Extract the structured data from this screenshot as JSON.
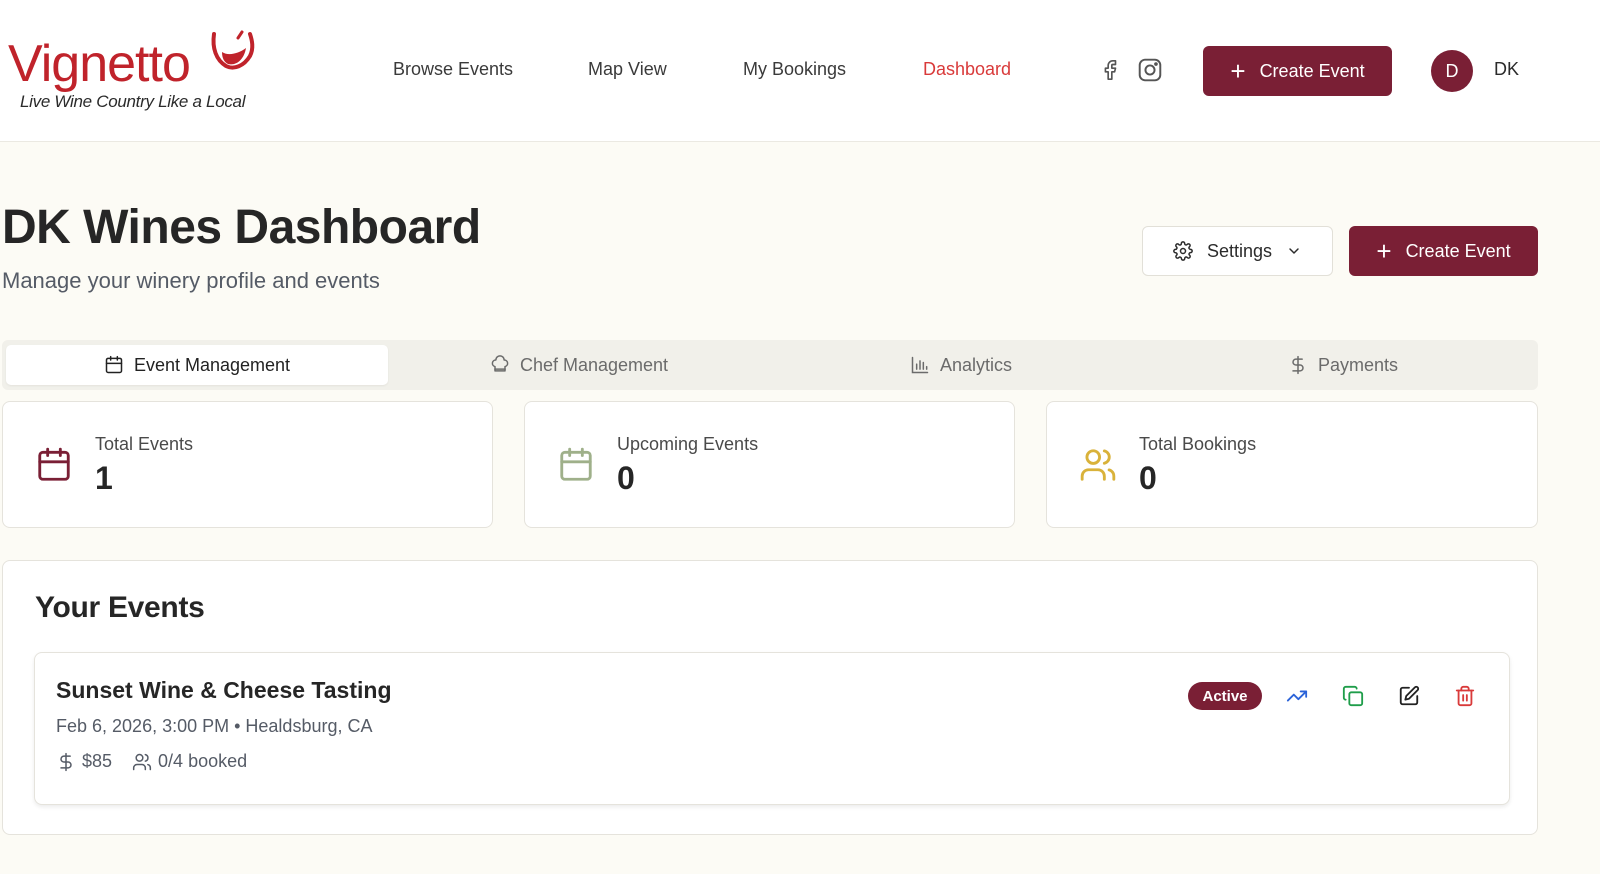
{
  "brand": {
    "name": "Vignetto",
    "tagline": "Live Wine Country Like a Local",
    "color": "#c0232b"
  },
  "nav": {
    "items": [
      {
        "label": "Browse Events"
      },
      {
        "label": "Map View"
      },
      {
        "label": "My Bookings"
      },
      {
        "label": "Dashboard",
        "active": true
      }
    ],
    "social": [
      "facebook-icon",
      "instagram-icon"
    ],
    "create_label": "Create Event"
  },
  "user": {
    "avatar_letter": "D",
    "initials": "DK"
  },
  "page": {
    "title": "DK Wines Dashboard",
    "subtitle": "Manage your winery profile and events",
    "settings_label": "Settings",
    "create_label": "Create Event"
  },
  "tabs": [
    {
      "label": "Event Management",
      "icon": "calendar-icon",
      "active": true
    },
    {
      "label": "Chef Management",
      "icon": "chef-hat-icon"
    },
    {
      "label": "Analytics",
      "icon": "bar-chart-icon"
    },
    {
      "label": "Payments",
      "icon": "dollar-icon"
    }
  ],
  "stats": [
    {
      "label": "Total Events",
      "value": "1",
      "icon": "calendar-icon",
      "color": "#7a1f35"
    },
    {
      "label": "Upcoming Events",
      "value": "0",
      "icon": "calendar-icon",
      "color": "#9fb08a"
    },
    {
      "label": "Total Bookings",
      "value": "0",
      "icon": "users-icon",
      "color": "#d9b23a"
    }
  ],
  "events_section": {
    "title": "Your Events",
    "events": [
      {
        "title": "Sunset Wine & Cheese Tasting",
        "meta": "Feb 6, 2026, 3:00 PM • Healdsburg, CA",
        "price": "$85",
        "booked": "0/4 booked",
        "status": "Active"
      }
    ]
  },
  "colors": {
    "primary": "#7a1f35",
    "active_nav": "#d93a3a",
    "background": "#fcfbf5"
  }
}
